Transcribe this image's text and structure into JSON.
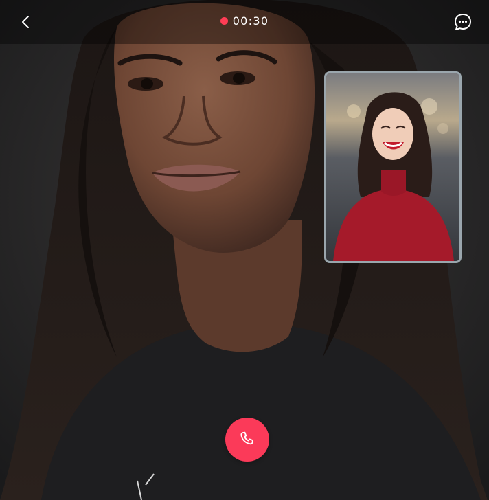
{
  "call": {
    "duration": "00:30",
    "recording_indicator_color": "#ff3d55",
    "end_call_color": "#fb3a59"
  },
  "header": {
    "back_icon": "chevron-left-icon",
    "chat_icon": "chat-bubble-icon"
  },
  "remote_video": {
    "description_icon": "remote-participant-video"
  },
  "self_view": {
    "description_icon": "local-camera-preview"
  },
  "controls": {
    "end_call_icon": "phone-icon"
  }
}
